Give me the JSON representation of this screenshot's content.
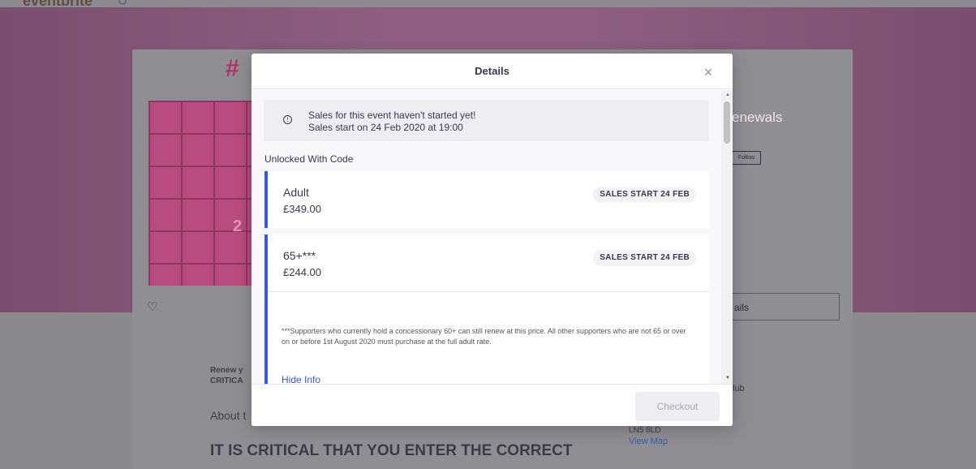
{
  "background": {
    "logo": "eventbrite",
    "hash_text": "#",
    "image_number": "2",
    "title_fragment": "enewals",
    "follow_label": "Follow",
    "details_fragment": "ails",
    "renew_line1": "Renew y",
    "renew_line2": "CRITICA",
    "about_label": "About t",
    "critical_heading": "IT IS CRITICAL THAT YOU ENTER THE CORRECT",
    "club_fragment": "lub",
    "postcode": "LN5 8LD",
    "view_map": "View Map"
  },
  "modal": {
    "title": "Details",
    "notice": {
      "line1": "Sales for this event haven't started yet!",
      "line2": "Sales start on 24 Feb 2020 at 19:00"
    },
    "section_label": "Unlocked With Code",
    "tickets": [
      {
        "name": "Adult",
        "price": "£349.00",
        "badge": "SALES START 24 FEB"
      },
      {
        "name": "65+***",
        "price": "£244.00",
        "badge": "SALES START 24 FEB",
        "info": "***Supporters who currently hold a  concessionary 60+ can still renew at this price. All other supporters who are not 65 or over on or before 1st August 2020 must purchase at the full adult rate.",
        "hide_info": "Hide Info"
      }
    ],
    "checkout_label": "Checkout"
  },
  "icons": {
    "close": "close-icon",
    "info": "info-icon",
    "heart": "heart-icon",
    "search": "search-icon"
  },
  "colors": {
    "accent": "#3659e3",
    "text": "#39364f",
    "overlay": "#8a8a8e"
  }
}
